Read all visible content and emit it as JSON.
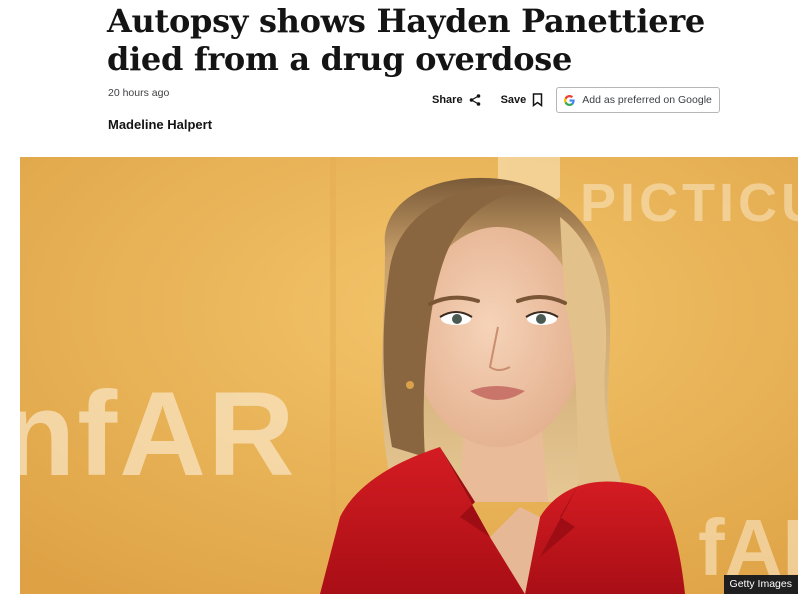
{
  "article": {
    "headline": "Autopsy shows Hayden Panettiere died from a drug overdose",
    "timestamp": "20 hours ago",
    "byline": "Madeline Halpert"
  },
  "actions": {
    "share_label": "Share",
    "save_label": "Save",
    "google_label": "Add as preferred on Google"
  },
  "image": {
    "credit": "Getty Images",
    "backdrop_text_1": "PICTICU",
    "backdrop_text_2": "nfAR",
    "backdrop_text_3": "fAR"
  },
  "icons": {
    "share": "share-icon",
    "save": "bookmark-icon",
    "google": "google-g-icon"
  },
  "colors": {
    "backdrop": "#e9b04f",
    "jacket": "#c8141c",
    "hair": "#d9b37c",
    "text": "#141414"
  }
}
